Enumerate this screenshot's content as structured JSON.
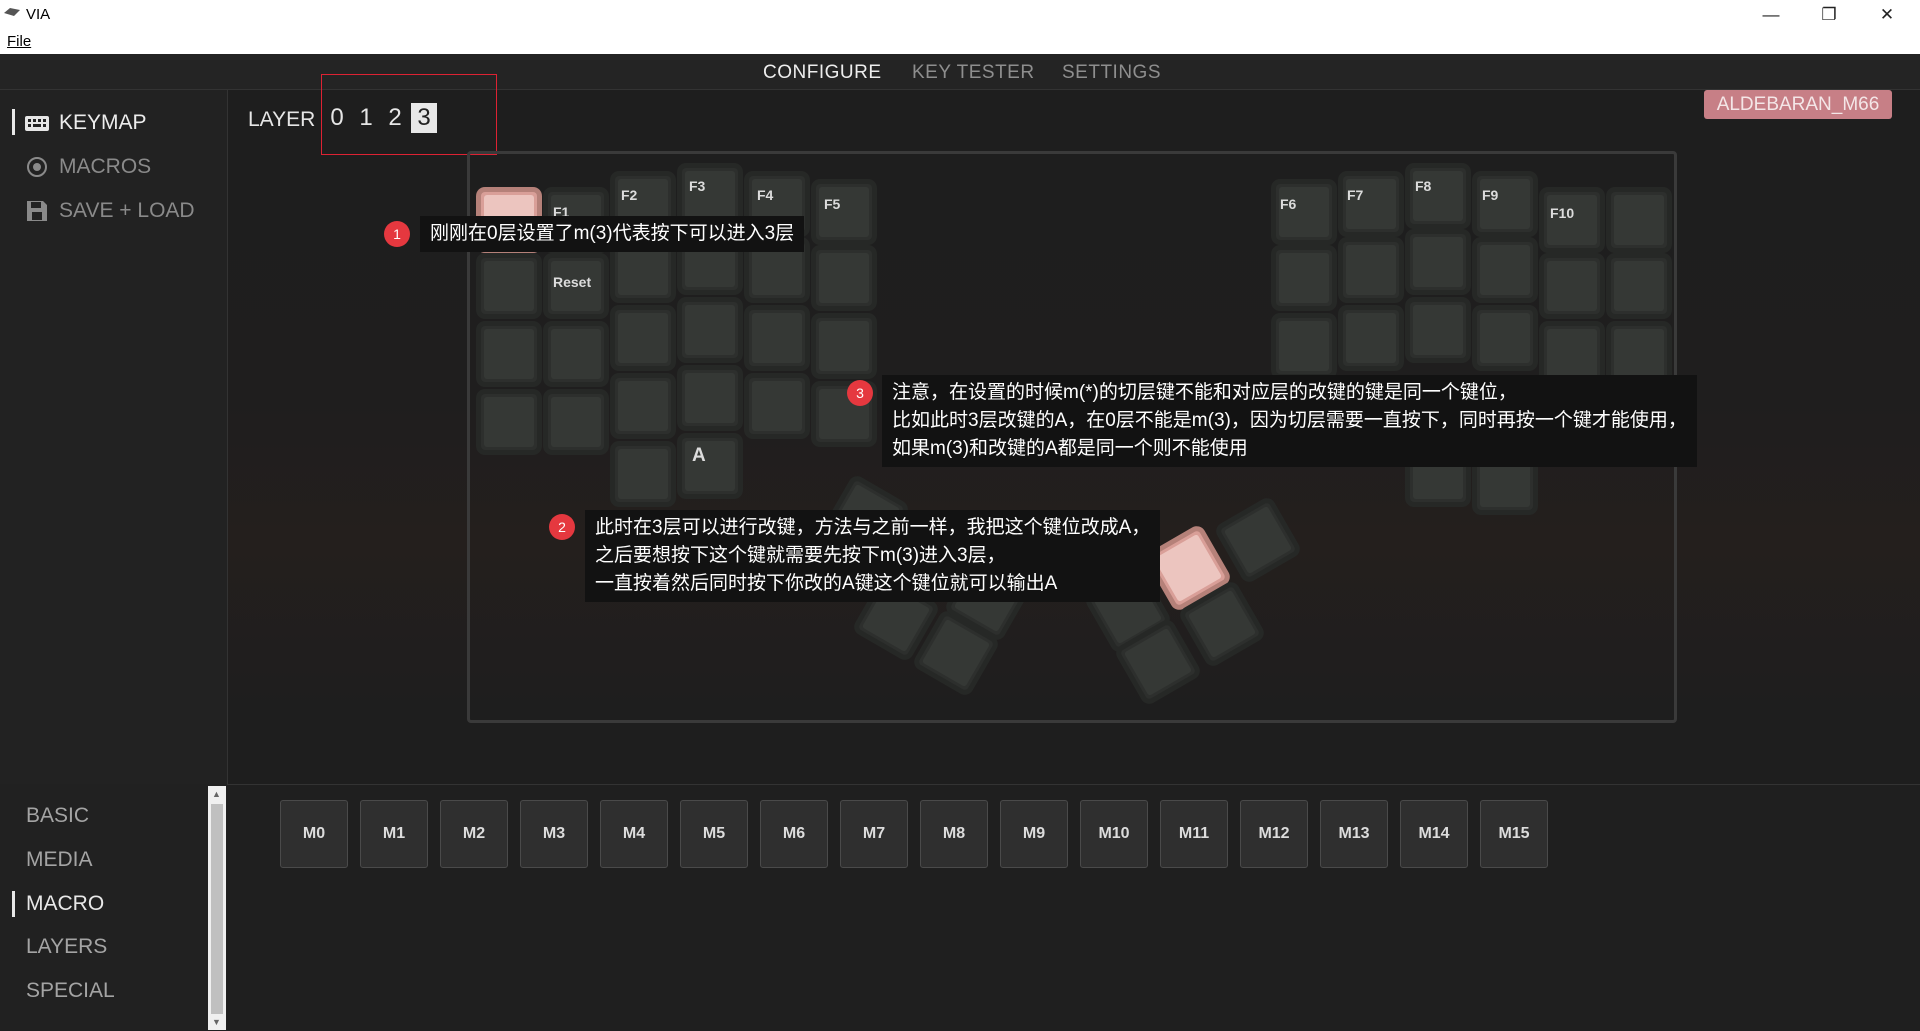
{
  "window": {
    "title": "VIA",
    "min": "—",
    "restore": "❐",
    "close": "✕"
  },
  "menu": {
    "file": "File"
  },
  "nav": {
    "configure": "CONFIGURE",
    "key_tester": "KEY TESTER",
    "settings": "SETTINGS"
  },
  "sidebar": {
    "keymap": "KEYMAP",
    "macros": "MACROS",
    "save_load": "SAVE + LOAD"
  },
  "layer": {
    "label": "LAYER",
    "l0": "0",
    "l1": "1",
    "l2": "2",
    "l3": "3",
    "active": 3
  },
  "device": {
    "name": "ALDEBARAN_M66"
  },
  "keys": {
    "f1": "F1",
    "f2": "F2",
    "f3": "F3",
    "f4": "F4",
    "f5": "F5",
    "f6": "F6",
    "f7": "F7",
    "f8": "F8",
    "f9": "F9",
    "f10": "F10",
    "reset": "Reset",
    "a": "A"
  },
  "callouts": {
    "c1_num": "1",
    "c1_text": "刚刚在0层设置了m(3)代表按下可以进入3层",
    "c2_num": "2",
    "c2_text": "此时在3层可以进行改键，方法与之前一样，我把这个键位改成A，\n之后要想按下这个键就需要先按下m(3)进入3层，\n一直按着然后同时按下你改的A键这个键位就可以输出A",
    "c3_num": "3",
    "c3_text": "注意，在设置的时候m(*)的切层键不能和对应层的改键的键是同一个键位，\n比如此时3层改键的A，在0层不能是m(3)，因为切层需要一直按下，同时再按一个键才能使用，\n如果m(3)和改键的A都是同一个则不能使用"
  },
  "categories": {
    "basic": "BASIC",
    "media": "MEDIA",
    "macro": "MACRO",
    "layers": "LAYERS",
    "special": "SPECIAL",
    "selected": "MACRO"
  },
  "macro_keys": [
    "M0",
    "M1",
    "M2",
    "M3",
    "M4",
    "M5",
    "M6",
    "M7",
    "M8",
    "M9",
    "M10",
    "M11",
    "M12",
    "M13",
    "M14",
    "M15"
  ],
  "colors": {
    "accent_badge": "#c77f86",
    "highlight_key": "#ecc5bf",
    "callout_dot": "#e5383f",
    "layer_box": "#dd2233"
  }
}
